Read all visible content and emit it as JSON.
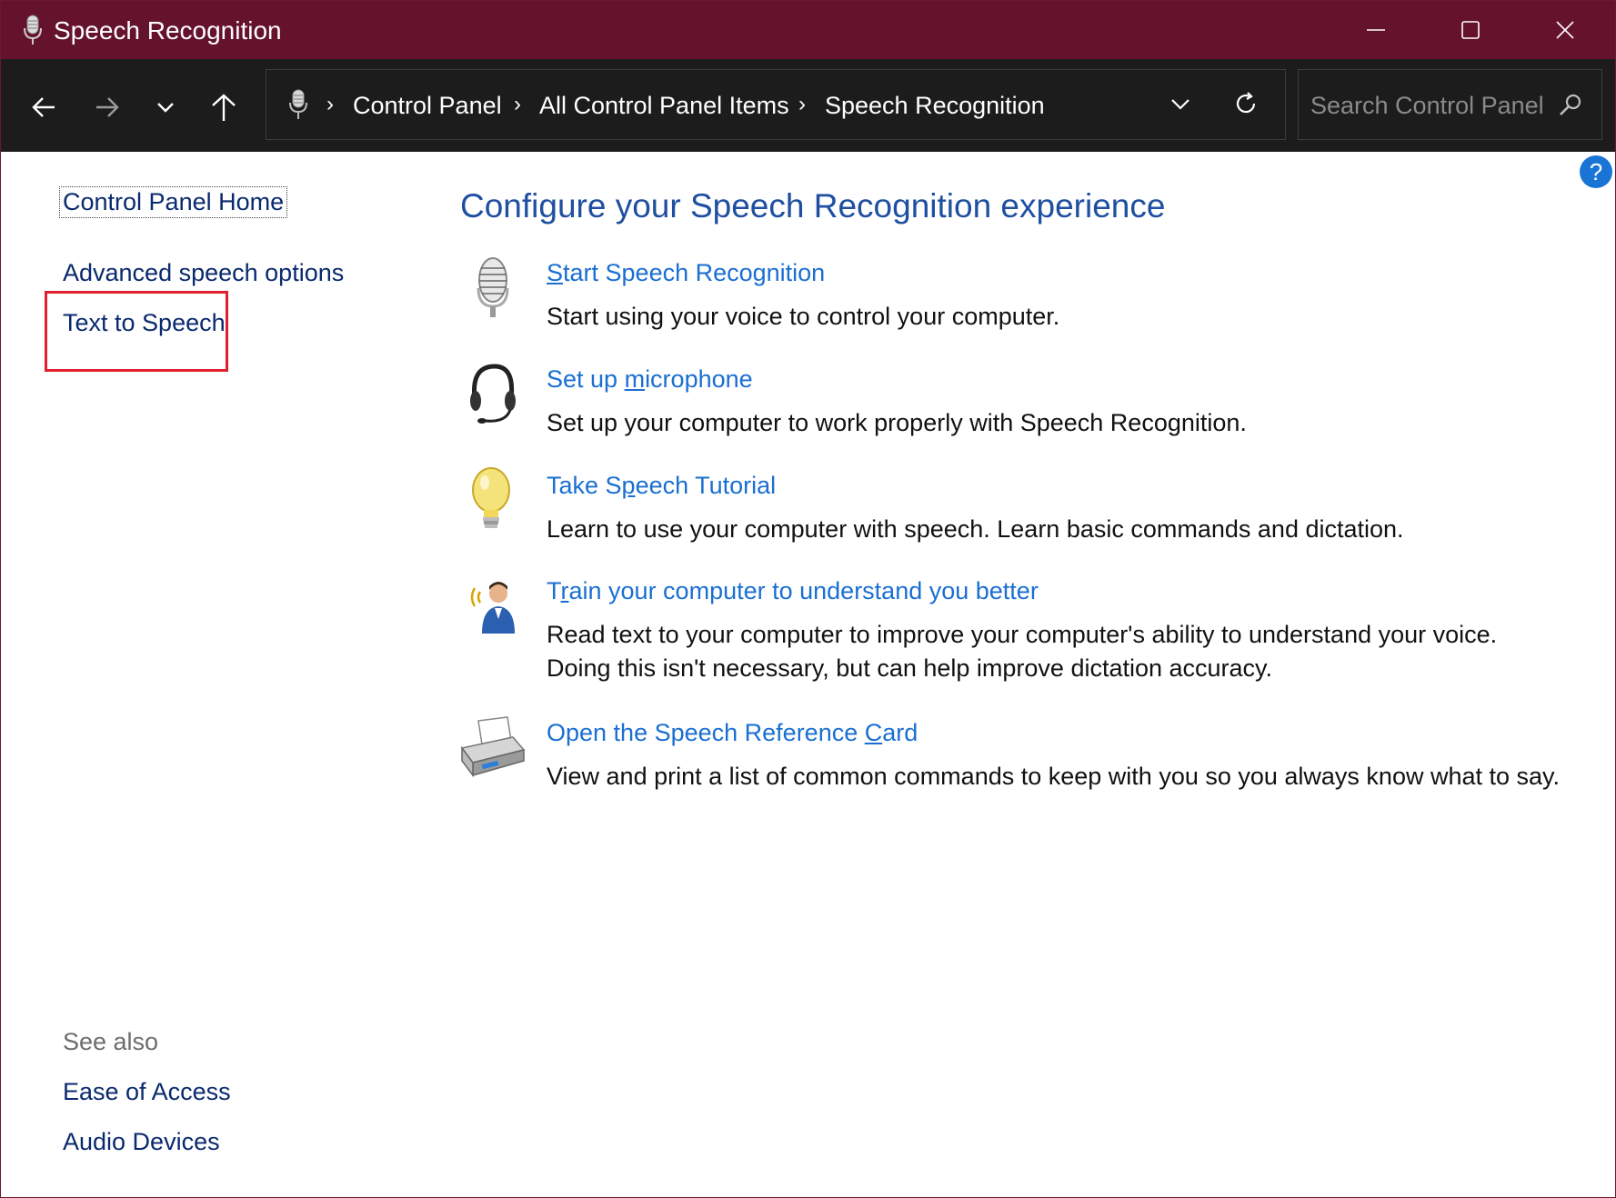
{
  "window": {
    "title": "Speech Recognition",
    "accent_color": "#65122c"
  },
  "titlebar": {
    "minimize_icon": "minimize-icon",
    "maximize_icon": "maximize-icon",
    "close_icon": "close-icon"
  },
  "nav": {
    "back_icon": "arrow-left-icon",
    "forward_icon": "arrow-right-icon",
    "recent_icon": "chevron-down-icon",
    "up_icon": "arrow-up-icon"
  },
  "address": {
    "breadcrumbs": [
      "Control Panel",
      "All Control Panel Items",
      "Speech Recognition"
    ],
    "separator": "›"
  },
  "search": {
    "placeholder": "Search Control Panel",
    "value": ""
  },
  "help": {
    "label": "?"
  },
  "sidebar": {
    "home": "Control Panel Home",
    "links": [
      "Advanced speech options",
      "Text to Speech"
    ],
    "highlighted": "Text to Speech",
    "see_also_label": "See also",
    "see_also": [
      "Ease of Access",
      "Audio Devices"
    ]
  },
  "main": {
    "title": "Configure your Speech Recognition experience",
    "tasks": [
      {
        "icon": "microphone-icon",
        "link_pre": "",
        "link_key": "S",
        "link_post": "tart Speech Recognition",
        "desc": [
          "Start using your voice to control your computer."
        ]
      },
      {
        "icon": "headset-icon",
        "link_pre": "Set up ",
        "link_key": "m",
        "link_post": "icrophone",
        "desc": [
          "Set up your computer to work properly with Speech Recognition."
        ]
      },
      {
        "icon": "lightbulb-icon",
        "link_pre": "Take S",
        "link_key": "p",
        "link_post": "eech Tutorial",
        "desc": [
          "Learn to use your computer with speech. Learn basic commands and dictation."
        ]
      },
      {
        "icon": "person-speaking-icon",
        "link_pre": "T",
        "link_key": "r",
        "link_post": "ain your computer to understand you better",
        "desc": [
          "Read text to your computer to improve your computer's ability to understand your voice.",
          "Doing this isn't necessary, but can help improve dictation accuracy."
        ]
      },
      {
        "icon": "printer-icon",
        "link_pre": "Open the Speech Reference ",
        "link_key": "C",
        "link_post": "ard",
        "desc": [
          "View and print a list of common commands to keep with you so you always know what to say."
        ]
      }
    ]
  }
}
